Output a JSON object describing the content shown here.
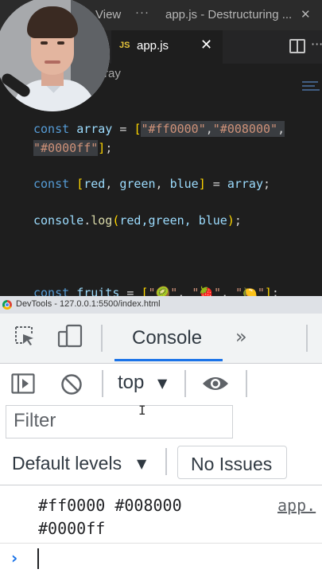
{
  "vscode": {
    "titlebar": {
      "view_label": "View",
      "more": "···",
      "window_title": "app.js - Destructuring ...",
      "close": "✕"
    },
    "tab": {
      "lang_badge": "JS",
      "filename": "app.js",
      "close": "✕"
    },
    "breadcrumb": "ray",
    "more_actions": "···",
    "code": {
      "line1": {
        "kw": "const ",
        "name": "array",
        "eq": " = ",
        "open": "[",
        "s1": "\"#ff0000\"",
        "c1": ",",
        "s2": "\"#008000\"",
        "c2": ","
      },
      "line2": {
        "s3": "\"#0000ff\"",
        "close": "]",
        "semi": ";"
      },
      "line3": {
        "kw": "const ",
        "open": "[",
        "a": "red",
        "c1": ", ",
        "b": "green",
        "c2": ", ",
        "c": "blue",
        "close": "]",
        "eq": " = ",
        "name": "array",
        "semi": ";"
      },
      "line4": {
        "obj": "console",
        "dot": ".",
        "fn": "log",
        "open": "(",
        "args": "red,green, blue",
        "close": ")",
        "semi": ";"
      },
      "line5": {
        "kw": "const ",
        "name": "fruits",
        "eq": " = ",
        "open": "[",
        "s1": "\"🥝\"",
        "c1": ", ",
        "s2": "\"🍓\"",
        "c2": ", ",
        "s3": "\"🍋\"",
        "close": "]",
        "semi": ";"
      }
    }
  },
  "devtools": {
    "window_title": "DevTools - 127.0.0.1:5500/index.html",
    "tabs": {
      "console": "Console",
      "more": "»"
    },
    "context": "top",
    "filter_placeholder": "Filter",
    "levels": "Default levels",
    "issues": "No Issues",
    "output": {
      "line1": "#ff0000 #008000",
      "line2": "#0000ff",
      "source": "app."
    },
    "prompt": "›"
  },
  "colors": {
    "accent": "#1a73e8",
    "editor_bg": "#1e1e1e",
    "keyword": "#569cd6",
    "variable": "#9cdcfe",
    "string": "#ce9178",
    "function": "#dcdcaa"
  }
}
